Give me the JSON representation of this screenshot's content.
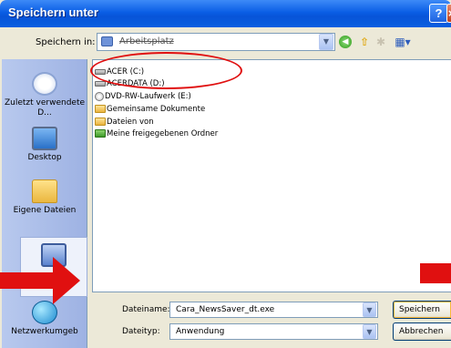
{
  "window": {
    "title": "Speichern unter",
    "help_label": "?",
    "close_label": "×"
  },
  "lookin": {
    "label": "Speichern in:",
    "value": "Arbeitsplatz"
  },
  "places": [
    {
      "label": "Zuletzt verwendete D..."
    },
    {
      "label": "Desktop"
    },
    {
      "label": "Eigene Dateien"
    },
    {
      "label": ""
    },
    {
      "label": "Netzwerkumgeb"
    }
  ],
  "files": [
    {
      "name": "ACER (C:)",
      "icon": "hard-drive-icon"
    },
    {
      "name": "ACERDATA (D:)",
      "icon": "hard-drive-icon"
    },
    {
      "name": "DVD-RW-Laufwerk (E:)",
      "icon": "dvd-drive-icon"
    },
    {
      "name": "Gemeinsame Dokumente",
      "icon": "folder-icon"
    },
    {
      "name": "Dateien von",
      "icon": "folder-icon"
    },
    {
      "name": "Meine freigegebenen Ordner",
      "icon": "shared-folder-icon"
    }
  ],
  "form": {
    "filename_label": "Dateiname:",
    "filename_value": "Cara_NewsSaver_dt.exe",
    "filetype_label": "Dateityp:",
    "filetype_value": "Anwendung"
  },
  "buttons": {
    "save": "Speichern",
    "cancel": "Abbrechen"
  },
  "colors": {
    "title_bar": "#0a5ee5",
    "annotation": "#e01010",
    "places_bar": "#b8c9ee"
  }
}
